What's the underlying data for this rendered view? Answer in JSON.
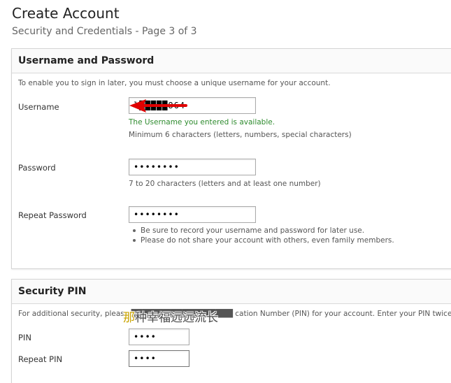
{
  "header": {
    "title": "Create Account",
    "subtitle": "Security and Credentials - Page 3 of 3"
  },
  "credentials": {
    "title": "Username and Password",
    "description": "To enable you to sign in later, you must choose a unique username for your account.",
    "username": {
      "label": "Username",
      "value": "l█████864",
      "status": "The Username you entered is available.",
      "hint": "Minimum 6 characters (letters, numbers, special characters)"
    },
    "password": {
      "label": "Password",
      "value": "••••••••",
      "hint": "7 to 20 characters (letters and at least one number)"
    },
    "repeat_password": {
      "label": "Repeat Password",
      "value": "••••••••",
      "notes": [
        "Be sure to record your username and password for later use.",
        "Please do not share your account with others, even family members."
      ]
    }
  },
  "pin_section": {
    "title": "Security PIN",
    "description": "For additional security, please ██████████████████ cation Number (PIN) for your account. Enter your PIN twice to m",
    "pin": {
      "label": "PIN",
      "value": "••••"
    },
    "repeat_pin": {
      "label": "Repeat PIN",
      "value": "••••"
    }
  },
  "overlay": {
    "subtitle_first": "那",
    "subtitle_rest": "种幸福远远流长"
  },
  "colors": {
    "arrow": "#e00000",
    "available": "#2e8b2e"
  }
}
